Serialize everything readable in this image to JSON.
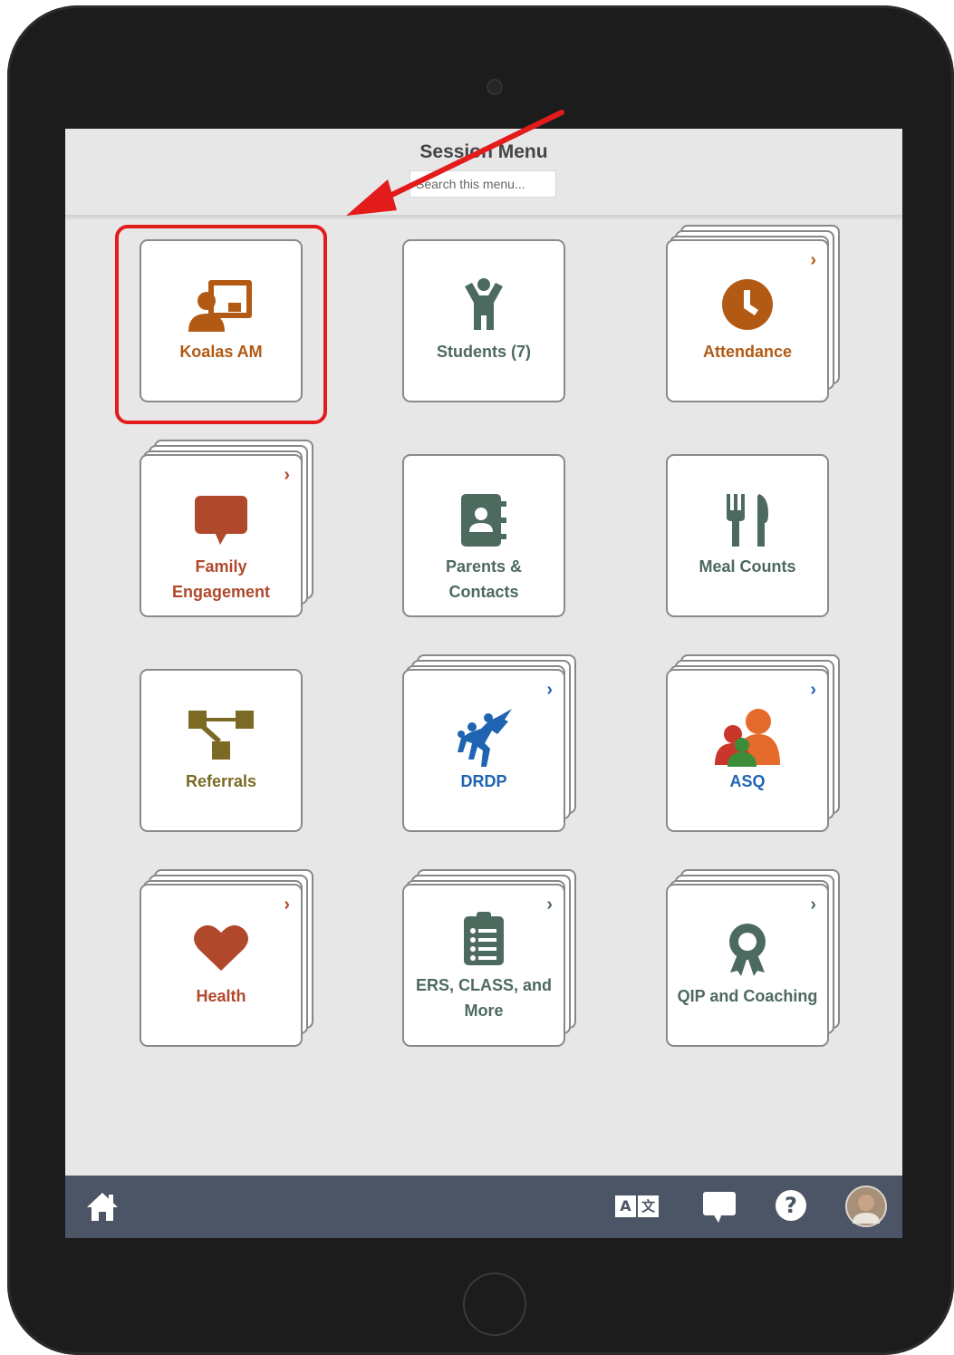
{
  "header": {
    "title": "Session Menu",
    "search_placeholder": "Search this menu..."
  },
  "colors": {
    "brown": "#b25a14",
    "sienna": "#b0492c",
    "green": "#4d6a5f",
    "olive": "#7a6a23",
    "blue": "#1f64b3",
    "highlight": "#e31b1b",
    "bottom_bar": "#4c5565"
  },
  "tiles": [
    {
      "label": "Koalas AM",
      "icon": "classroom-teacher-icon",
      "stacked": false
    },
    {
      "label": "Students (7)",
      "icon": "child-icon",
      "stacked": false
    },
    {
      "label": "Attendance",
      "icon": "clock-icon",
      "stacked": true
    },
    {
      "label": "Family Engagement",
      "icon": "speech-bubble-icon",
      "stacked": true
    },
    {
      "label": "Parents & Contacts",
      "icon": "address-book-icon",
      "stacked": false
    },
    {
      "label": "Meal Counts",
      "icon": "utensils-icon",
      "stacked": false
    },
    {
      "label": "Referrals",
      "icon": "sitemap-icon",
      "stacked": false
    },
    {
      "label": "DRDP",
      "icon": "drdp-logo-icon",
      "stacked": true
    },
    {
      "label": "ASQ",
      "icon": "asq-logo-icon",
      "stacked": true
    },
    {
      "label": "Health",
      "icon": "heart-icon",
      "stacked": true
    },
    {
      "label": "ERS, CLASS, and More",
      "icon": "clipboard-list-icon",
      "stacked": true
    },
    {
      "label": "QIP and Coaching",
      "icon": "award-ribbon-icon",
      "stacked": true
    }
  ],
  "bottom_bar": {
    "icons": [
      "home-icon",
      "translate-icon",
      "chat-icon",
      "help-icon",
      "user-avatar"
    ],
    "translate_glyphs": [
      "A",
      "文"
    ],
    "help_glyph": "?"
  }
}
